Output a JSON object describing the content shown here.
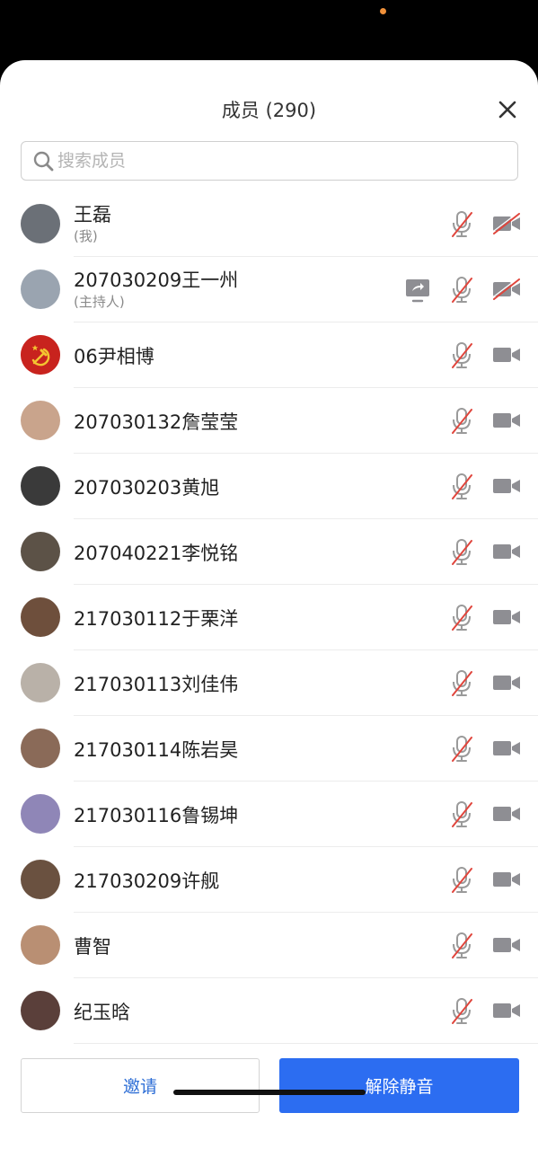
{
  "header": {
    "title": "成员 (290)"
  },
  "search": {
    "placeholder": "搜索成员"
  },
  "members": [
    {
      "name": "王磊",
      "role": "(我)",
      "avatar_color": "#6b7077",
      "sharing": false,
      "mic": "muted",
      "camera": "off"
    },
    {
      "name": "207030209王一州",
      "role": "(主持人)",
      "avatar_color": "#9aa4b0",
      "sharing": true,
      "mic": "muted",
      "camera": "off"
    },
    {
      "name": "06尹相博",
      "role": "",
      "avatar_color": "#c8231e",
      "sharing": false,
      "mic": "muted",
      "camera": "on"
    },
    {
      "name": "207030132詹莹莹",
      "role": "",
      "avatar_color": "#c9a48c",
      "sharing": false,
      "mic": "muted",
      "camera": "on"
    },
    {
      "name": "207030203黄旭",
      "role": "",
      "avatar_color": "#3a3a3a",
      "sharing": false,
      "mic": "muted",
      "camera": "on"
    },
    {
      "name": "207040221李悦铭",
      "role": "",
      "avatar_color": "#5c5247",
      "sharing": false,
      "mic": "muted",
      "camera": "on"
    },
    {
      "name": "217030112于栗洋",
      "role": "",
      "avatar_color": "#6e4f3c",
      "sharing": false,
      "mic": "muted",
      "camera": "on"
    },
    {
      "name": "217030113刘佳伟",
      "role": "",
      "avatar_color": "#b9b1a8",
      "sharing": false,
      "mic": "muted",
      "camera": "on"
    },
    {
      "name": "217030114陈岩昊",
      "role": "",
      "avatar_color": "#8a6a58",
      "sharing": false,
      "mic": "muted",
      "camera": "on"
    },
    {
      "name": "217030116鲁锡坤",
      "role": "",
      "avatar_color": "#8f86b7",
      "sharing": false,
      "mic": "muted",
      "camera": "on"
    },
    {
      "name": "217030209许舰",
      "role": "",
      "avatar_color": "#6a5140",
      "sharing": false,
      "mic": "muted",
      "camera": "on"
    },
    {
      "name": "曹智",
      "role": "",
      "avatar_color": "#b98f73",
      "sharing": false,
      "mic": "muted",
      "camera": "on"
    },
    {
      "name": "纪玉晗",
      "role": "",
      "avatar_color": "#5a3f3a",
      "sharing": false,
      "mic": "muted",
      "camera": "on"
    }
  ],
  "footer": {
    "invite_label": "邀请",
    "unmute_label": "解除静音"
  },
  "colors": {
    "accent": "#2c6df1",
    "muted_red": "#e0453c",
    "icon_gray": "#8e8e93"
  }
}
